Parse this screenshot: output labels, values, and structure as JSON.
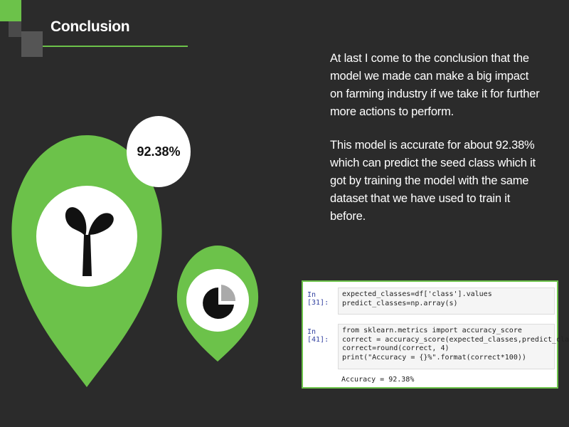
{
  "slide": {
    "title": "Conclusion",
    "paragraphs": [
      "At last I come to the conclusion that the model we made can make a big impact on farming industry if  we take it for further more actions to perform.",
      "This model is accurate for about 92.38% which can predict the seed class which it got by training the model with the same dataset that we have used to train it before."
    ],
    "badge": "92.38%"
  },
  "icons": {
    "large_pin": "seedling-icon",
    "small_pin": "pie-chart-icon"
  },
  "colors": {
    "background": "#2b2b2b",
    "accent": "#6cc24a",
    "dark_square": "#4a4a4a"
  },
  "notebook": {
    "cell1": {
      "prompt": "In [31]:",
      "lines": [
        "expected_classes=df['class'].values",
        "predict_classes=np.array(s)"
      ]
    },
    "cell2": {
      "prompt": "In [41]:",
      "lines": [
        "from sklearn.metrics import accuracy_score",
        "correct = accuracy_score(expected_classes,predict_classes)",
        "correct=round(correct, 4)",
        "print(\"Accuracy = {}%\".format(correct*100))"
      ],
      "output": "Accuracy = 92.38%"
    }
  }
}
